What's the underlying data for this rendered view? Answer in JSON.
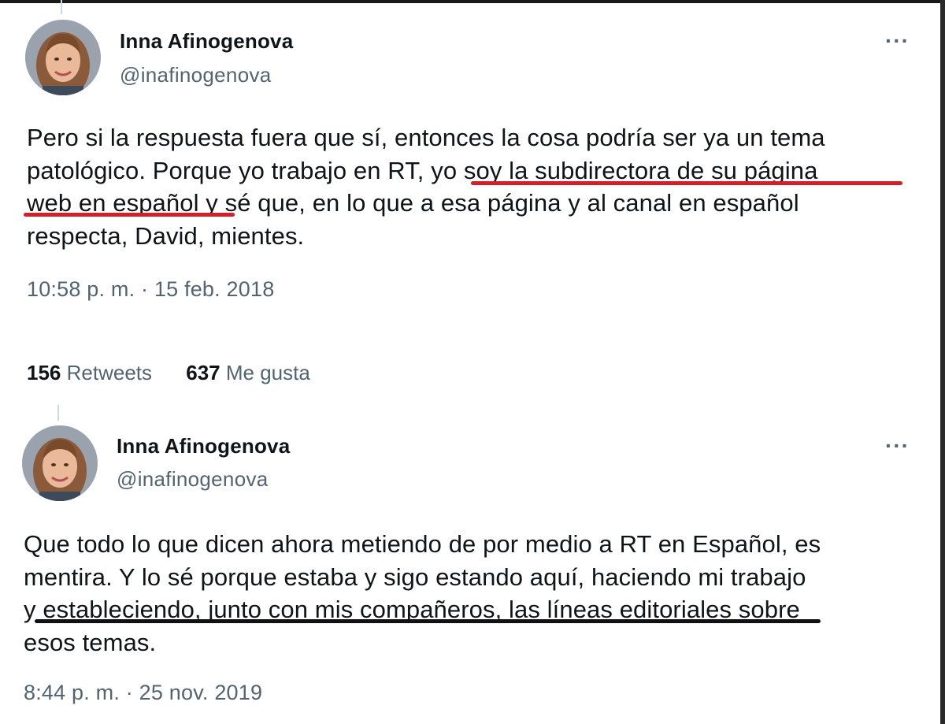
{
  "tweets": [
    {
      "author_name": "Inna Afinogenova",
      "handle": "@inafinogenova",
      "more_icon": "more-horizontal-icon",
      "text_lines": [
        "Pero si la respuesta fuera que sí, entonces la cosa podría ser ya un tema",
        "patológico. Porque yo trabajo en RT, yo soy la subdirectora de su página",
        "web en español y sé que, en lo que a esa página y al canal en español",
        "respecta, David, mientes."
      ],
      "timestamp": "10:58 p. m. · 15 feb. 2018",
      "retweets_count": "156",
      "retweets_label": "Retweets",
      "likes_count": "637",
      "likes_label": "Me gusta",
      "underline_color": "#d0202a"
    },
    {
      "author_name": "Inna Afinogenova",
      "handle": "@inafinogenova",
      "more_icon": "more-horizontal-icon",
      "text_lines": [
        "Que todo lo que dicen ahora metiendo de por medio a RT en Español, es",
        "mentira. Y lo sé porque estaba y sigo estando aquí, haciendo mi trabajo",
        "y estableciendo, junto con mis compañeros, las líneas editoriales sobre",
        "esos temas."
      ],
      "timestamp": "8:44 p. m. · 25 nov. 2019",
      "underline_color": "#111111"
    }
  ]
}
